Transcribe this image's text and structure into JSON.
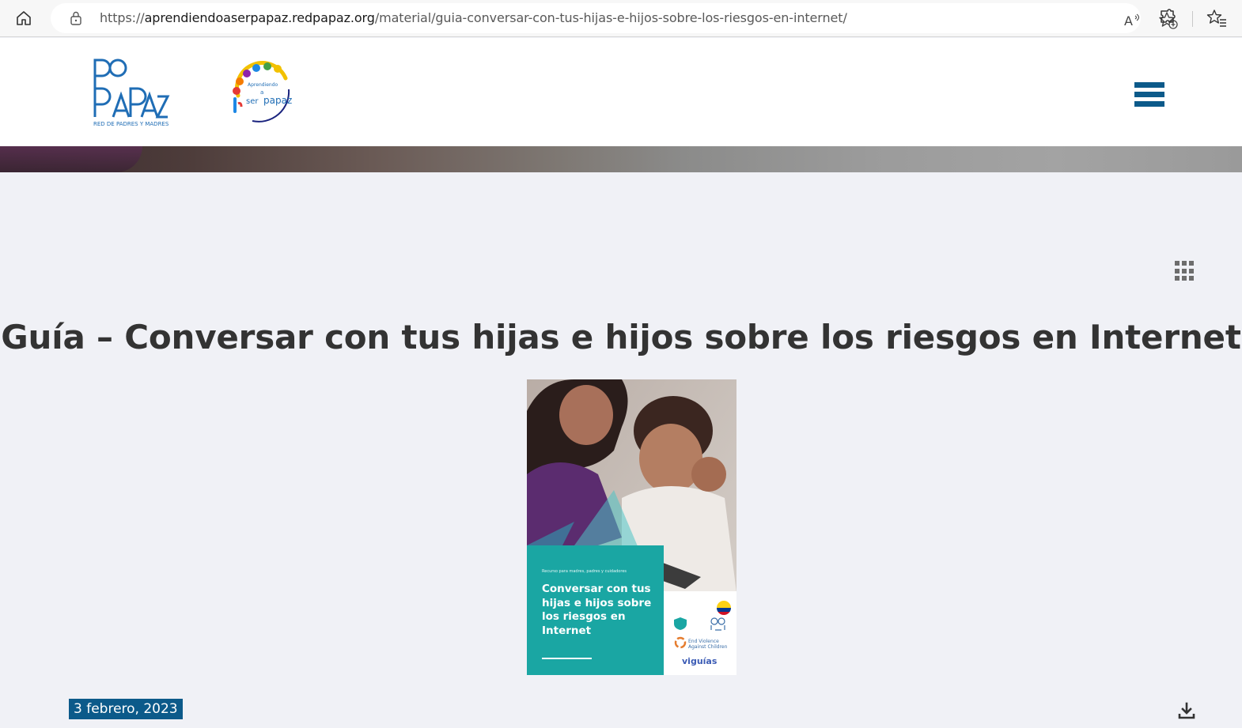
{
  "browser": {
    "url_prefix": "https://",
    "url_host": "aprendiendoaserpapaz.redpapaz.org",
    "url_path": "/material/guia-conversar-con-tus-hijas-e-hijos-sobre-los-riesgos-en-internet/",
    "read_aloud_label": "À"
  },
  "header": {
    "logo_main_text": "RED DE PADRES Y MADRES",
    "logo_secondary_text": "Aprendiendo a ser papaz"
  },
  "main": {
    "title": "Guía – Conversar con tus hijas e hijos sobre los riesgos en Internet",
    "cover": {
      "subtitle": "Recurso para madres, padres y cuidadores",
      "title": "Conversar con tus hijas e hijos sobre los riesgos en Internet",
      "logo1": "End Violence Against Children",
      "logo2": "viguías"
    },
    "date": "3 febrero, 2023"
  },
  "colors": {
    "brand_blue": "#0c5a8a",
    "teal": "#1aa6a3",
    "page_bg": "#f0f1f6"
  }
}
